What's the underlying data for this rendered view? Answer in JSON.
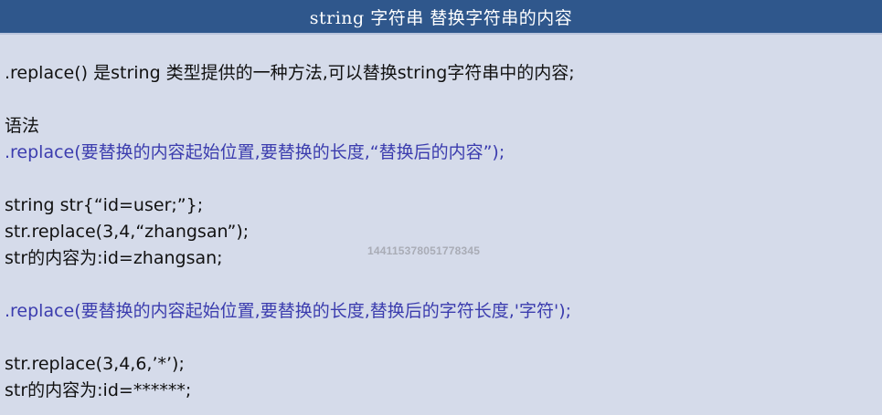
{
  "slide": {
    "title": "string 字符串 替换字符串的内容",
    "lines": {
      "intro": ".replace() 是string 类型提供的一种方法,可以替换string字符串中的内容;",
      "syntax_label": "语法",
      "syntax_1": ".replace(要替换的内容起始位置,要替换的长度,“替换后的内容”);",
      "example_1_decl": "string str{“id=user;”};",
      "example_1_call": "str.replace(3,4,“zhangsan”);",
      "example_1_result": "str的内容为:id=zhangsan;",
      "syntax_2": ".replace(要替换的内容起始位置,要替换的长度,替换后的字符长度,'字符');",
      "example_2_call": "str.replace(3,4,6,’*’);",
      "example_2_result": "str的内容为:id=******;"
    },
    "watermark": "144115378051778345",
    "colors": {
      "title_bar": "#2f578c",
      "background": "#d5dbea",
      "syntax_accent": "#3b3cae",
      "text": "#111111"
    }
  }
}
